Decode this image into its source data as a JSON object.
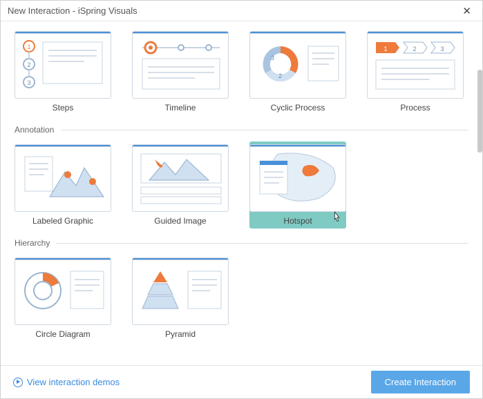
{
  "window": {
    "title": "New Interaction - iSpring Visuals"
  },
  "sections": [
    {
      "name": null,
      "items": [
        {
          "key": "steps",
          "label": "Steps"
        },
        {
          "key": "timeline",
          "label": "Timeline"
        },
        {
          "key": "cyclic",
          "label": "Cyclic Process"
        },
        {
          "key": "process",
          "label": "Process"
        }
      ]
    },
    {
      "name": "Annotation",
      "items": [
        {
          "key": "labeled",
          "label": "Labeled Graphic"
        },
        {
          "key": "guided",
          "label": "Guided Image"
        },
        {
          "key": "hotspot",
          "label": "Hotspot",
          "selected": true
        }
      ]
    },
    {
      "name": "Hierarchy",
      "items": [
        {
          "key": "circle",
          "label": "Circle Diagram"
        },
        {
          "key": "pyramid",
          "label": "Pyramid"
        }
      ]
    }
  ],
  "footer": {
    "demo_link": "View interaction demos",
    "create_button": "Create Interaction"
  }
}
